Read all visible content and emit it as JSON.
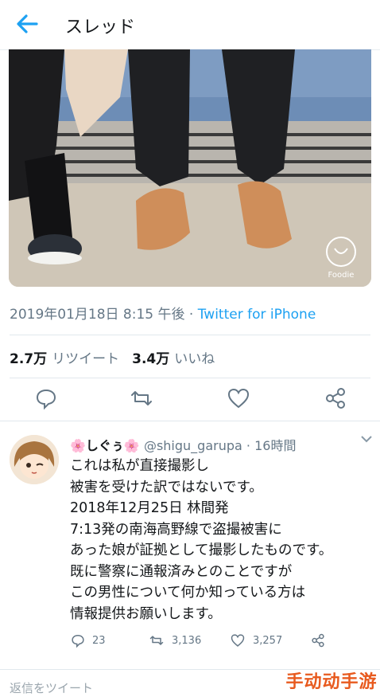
{
  "header": {
    "title": "スレッド"
  },
  "photo": {
    "watermark_text": "Foodie"
  },
  "tweet": {
    "timestamp": "2019年01月18日 8:15 午後",
    "separator": " · ",
    "via": "Twitter for iPhone",
    "retweet_count": "2.7万",
    "retweet_label": "リツイート",
    "like_count": "3.4万",
    "like_label": "いいね"
  },
  "reply": {
    "name": "🌸しぐぅ🌸",
    "handle": "@shigu_garupa",
    "time": "· 16時間",
    "body_lines": [
      "これは私が直接撮影し",
      "被害を受けた訳ではないです。",
      "2018年12月25日 林間発",
      "7:13発の南海高野線で盗撮被害に",
      "あった娘が証拠として撮影したものです。",
      "既に警察に通報済みとのことですが",
      "この男性について何か知っている方は",
      "情報提供お願いします。"
    ],
    "reply_count": "23",
    "retweet_count": "3,136",
    "like_count": "3,257"
  },
  "bottom": {
    "placeholder": "返信をツイート"
  },
  "site_watermark": "手动动手游",
  "colors": {
    "accent": "#1da1f2",
    "secondary_text": "#657786",
    "watermark": "#e85a1e"
  }
}
